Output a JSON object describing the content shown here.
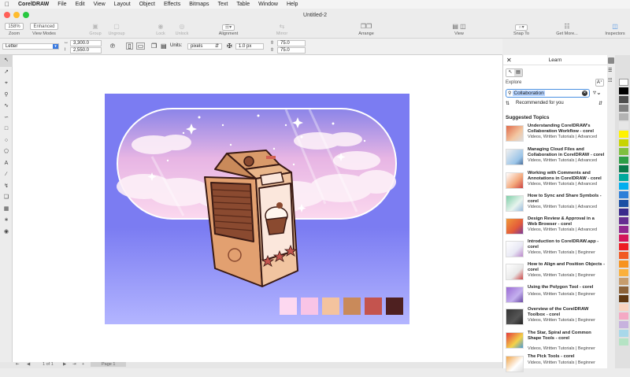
{
  "menubar": {
    "app_name": "CorelDRAW",
    "items": [
      "File",
      "Edit",
      "View",
      "Layout",
      "Object",
      "Effects",
      "Bitmaps",
      "Text",
      "Table",
      "Window",
      "Help"
    ]
  },
  "window": {
    "title": "Untitled-2"
  },
  "toolbar": {
    "zoom_value": "158%",
    "zoom_label": "Zoom",
    "view_mode_value": "Enhanced",
    "view_modes_label": "View Modes",
    "group_label": "Group",
    "ungroup_label": "Ungroup",
    "lock_label": "Lock",
    "unlock_label": "Unlock",
    "alignment_label": "Alignment",
    "mirror_label": "Mirror",
    "arrange_label": "Arrange",
    "view_label": "View",
    "snap_to_label": "Snap To",
    "get_more_label": "Get More...",
    "inspectors_label": "Inspectors"
  },
  "propbar": {
    "page_size": "Letter",
    "width": "3,300.0",
    "height": "2,550.0",
    "units_label": "Units:",
    "units_value": "pixels",
    "nudge": "1.0 px",
    "dup_x": "75.0",
    "dup_y": "75.0"
  },
  "status": {
    "page_counter": "1 of 1",
    "page_tab": "Page 1"
  },
  "learn": {
    "title": "Learn",
    "explore_label": "Explore",
    "search_value": "Collaboration",
    "sort_value": "Recommended for you",
    "suggested_label": "Suggested Topics",
    "topics": [
      {
        "title": "Understanding CorelDRAW's Collaboration Workflow - corel",
        "meta": "Videos, Written Tutorials | Advanced"
      },
      {
        "title": "Managing Cloud Files and Collaboration in CorelDRAW - corel",
        "meta": "Videos, Written Tutorials | Advanced"
      },
      {
        "title": "Working with Comments and Annotations in CorelDRAW - corel",
        "meta": "Videos, Written Tutorials | Advanced"
      },
      {
        "title": "How to Sync and Share Symbols - corel",
        "meta": "Videos, Written Tutorials | Advanced"
      },
      {
        "title": "Design Review & Approval in a Web Browser - corel",
        "meta": "Videos, Written Tutorials | Advanced"
      },
      {
        "title": "Introduction to CorelDRAW.app - corel",
        "meta": "Videos, Written Tutorials | Beginner"
      },
      {
        "title": "How to Align and Position Objects - corel",
        "meta": "Videos, Written Tutorials | Beginner"
      },
      {
        "title": "Using the Polygon Tool - corel",
        "meta": "Videos, Written Tutorials | Beginner"
      },
      {
        "title": "Overview of the CorelDRAW Toolbox - corel",
        "meta": "Videos, Written Tutorials | Beginner"
      },
      {
        "title": "The Star, Spiral and Common Shape Tools - corel",
        "meta": "Videos, Written Tutorials | Beginner"
      },
      {
        "title": "The Pick Tools - corel",
        "meta": "Videos, Written Tutorials | Beginner"
      }
    ]
  },
  "colors": {
    "artboard_bg": "#7b7cf2",
    "swatches": [
      "#fdd8f0",
      "#f9c4e6",
      "#f4c39e",
      "#c98a5a",
      "#c4544e",
      "#4e2020"
    ],
    "accent": "#4a90e2"
  },
  "icons": {
    "apple": "apple-icon",
    "tools": [
      "pick-tool-icon",
      "shape-tool-icon",
      "crop-tool-icon",
      "zoom-tool-icon",
      "freehand-tool-icon",
      "artistic-media-icon",
      "rectangle-tool-icon",
      "ellipse-tool-icon",
      "polygon-tool-icon",
      "text-tool-icon",
      "parallel-dimension-icon",
      "connector-tool-icon",
      "drop-shadow-icon",
      "transparency-icon",
      "eyedropper-icon",
      "interactive-fill-icon"
    ]
  }
}
